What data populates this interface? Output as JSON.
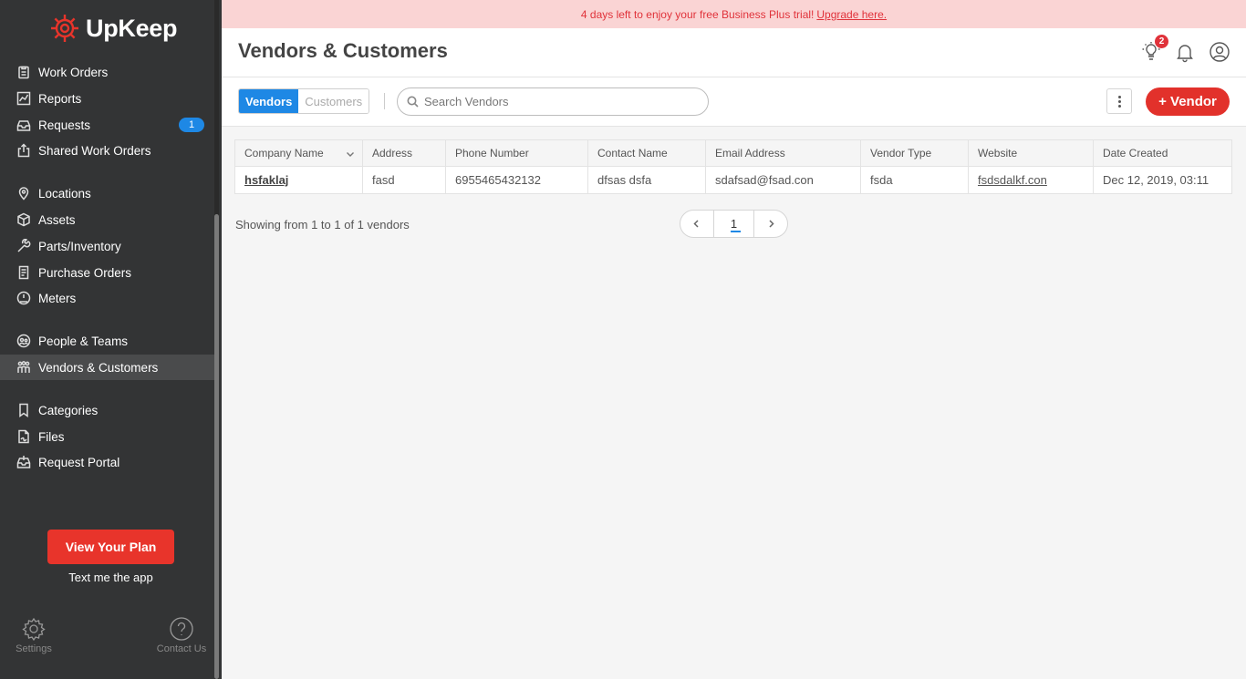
{
  "brand": {
    "name": "UpKeep",
    "accent": "#e8342b"
  },
  "banner": {
    "text": "4 days left to enjoy your free Business Plus trial!",
    "link": "Upgrade here."
  },
  "sidebar": {
    "items": [
      {
        "label": "Work Orders",
        "icon": "clipboard-icon"
      },
      {
        "label": "Reports",
        "icon": "chart-icon"
      },
      {
        "label": "Requests",
        "icon": "inbox-icon",
        "badge": "1"
      },
      {
        "label": "Shared Work Orders",
        "icon": "share-icon"
      },
      {
        "label": "Locations",
        "icon": "location-pin-icon"
      },
      {
        "label": "Assets",
        "icon": "cube-icon"
      },
      {
        "label": "Parts/Inventory",
        "icon": "wrench-icon"
      },
      {
        "label": "Purchase Orders",
        "icon": "document-icon"
      },
      {
        "label": "Meters",
        "icon": "gauge-icon"
      },
      {
        "label": "People & Teams",
        "icon": "people-icon"
      },
      {
        "label": "Vendors & Customers",
        "icon": "vendors-icon",
        "active": true
      },
      {
        "label": "Categories",
        "icon": "bookmark-icon"
      },
      {
        "label": "Files",
        "icon": "file-icon"
      },
      {
        "label": "Request Portal",
        "icon": "portal-icon"
      }
    ],
    "plan_button": "View Your Plan",
    "text_app": "Text me the app",
    "settings": "Settings",
    "contact": "Contact Us"
  },
  "header": {
    "title": "Vendors & Customers",
    "notification_count": "2"
  },
  "toolbar": {
    "tabs": [
      "Vendors",
      "Customers"
    ],
    "active_tab": "Vendors",
    "search_placeholder": "Search Vendors",
    "add_button": "+ Vendor"
  },
  "table": {
    "columns": [
      "Company Name",
      "Address",
      "Phone Number",
      "Contact Name",
      "Email Address",
      "Vendor Type",
      "Website",
      "Date Created"
    ],
    "rows": [
      [
        "hsfaklaj",
        "fasd",
        "6955465432132",
        "dfsas dsfa",
        "sdafsad@fsad.con",
        "fsda",
        "fsdsdalkf.con",
        "Dec 12, 2019, 03:11"
      ]
    ]
  },
  "pagination": {
    "summary": "Showing from 1 to 1 of 1 vendors",
    "current_page": "1"
  }
}
